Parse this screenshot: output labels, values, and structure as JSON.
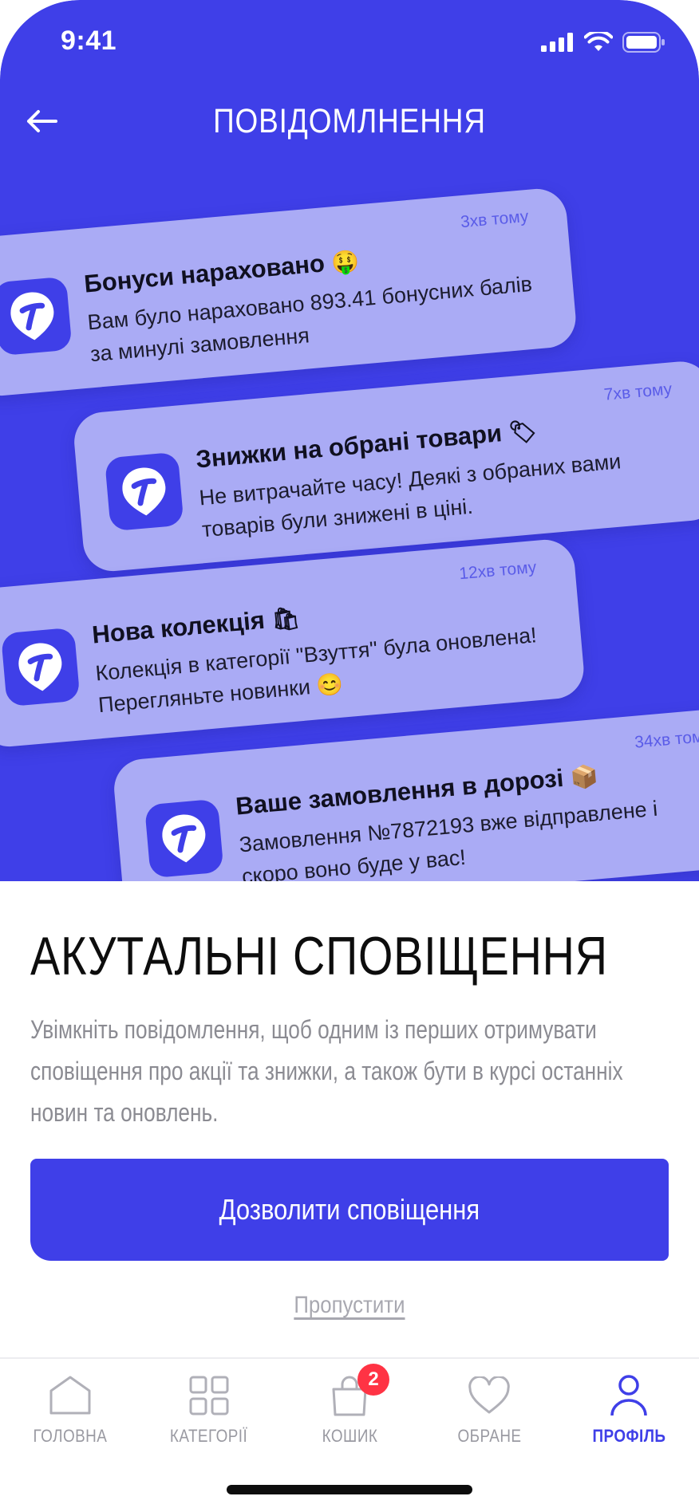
{
  "status_bar": {
    "time": "9:41"
  },
  "header": {
    "title": "ПОВІДОМЛНЕННЯ",
    "back_icon": "arrow-left-icon"
  },
  "notifications": [
    {
      "title": "Бонуси нараховано",
      "emoji": "🤑",
      "body": "Вам було нараховано 893.41 бонусних балів за минулі замовлення",
      "time": "3хв тому"
    },
    {
      "title": "Знижки на обрані товари",
      "emoji": "🏷",
      "body": "Не витрачайте часу! Деякі з обраних вами товарів були знижені в ціні.",
      "time": "7хв тому"
    },
    {
      "title": "Нова колекція",
      "emoji": "🛍",
      "body": "Колекція в категорії \"Взуття\" була оновлена! Перегляньте новинки 😊",
      "time": "12хв тому"
    },
    {
      "title": "Ваше замовлення в дорозі",
      "emoji": "📦",
      "body": "Замовлення №7872193 вже відправлене і скоро воно буде у вас!",
      "time": "34хв тому"
    }
  ],
  "content": {
    "headline": "АКУТАЛЬНІ СПОВІЩЕННЯ",
    "description": "Увімкніть повідомлення, щоб одним із перших отримувати сповіщення про акції та знижки, а також бути в курсі останніх новин та оновлень.",
    "primary_button": "Дозволити сповіщення",
    "skip_link": "Пропустити"
  },
  "tab_bar": {
    "items": [
      {
        "label": "ГОЛОВНА",
        "icon": "home-icon"
      },
      {
        "label": "КАТЕГОРІЇ",
        "icon": "grid-icon"
      },
      {
        "label": "КОШИК",
        "icon": "bag-icon",
        "badge": "2"
      },
      {
        "label": "ОБРАНЕ",
        "icon": "heart-icon"
      },
      {
        "label": "ПРОФІЛЬ",
        "icon": "profile-icon",
        "active": true
      }
    ]
  },
  "colors": {
    "brand": "#3f3fe8",
    "card": "#aaabf5",
    "badge": "#ff3344",
    "muted": "#8b8b92"
  }
}
